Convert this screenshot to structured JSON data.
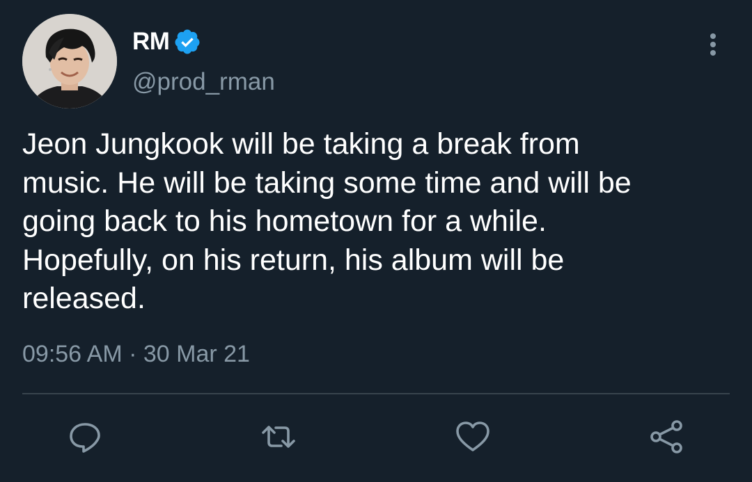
{
  "author": {
    "display_name": "RM",
    "handle": "@prod_rman",
    "verified": true,
    "verified_badge_icon": "verified-badge-icon",
    "avatar_icon": "avatar"
  },
  "tweet": {
    "text": "Jeon Jungkook will be taking a break from\nmusic. He will be taking some time and will be\ngoing back to his hometown for a while.\nHopefully, on his return, his album will be\nreleased.",
    "timestamp": "09:56 AM · 30 Mar 21"
  },
  "actions": [
    {
      "name": "reply",
      "icon": "reply-icon"
    },
    {
      "name": "retweet",
      "icon": "retweet-icon"
    },
    {
      "name": "like",
      "icon": "heart-icon"
    },
    {
      "name": "share",
      "icon": "share-icon"
    }
  ],
  "colors": {
    "background": "#15202b",
    "text": "#ffffff",
    "secondary_text": "#8899a6",
    "divider": "#38444d",
    "verified_blue": "#1da1f2"
  }
}
